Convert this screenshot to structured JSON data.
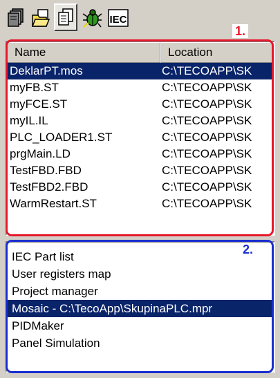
{
  "toolbar": {
    "buttons": [
      {
        "icon": "files-icon"
      },
      {
        "icon": "folder-icon"
      },
      {
        "icon": "documents-icon",
        "active": true
      },
      {
        "icon": "bug-icon"
      },
      {
        "icon": "iec-icon",
        "text": "IEC"
      }
    ]
  },
  "callouts": {
    "one": "1.",
    "two": "2."
  },
  "file_list": {
    "columns": [
      "Name",
      "Location"
    ],
    "rows": [
      {
        "name": "DeklarPT.mos",
        "location": "C:\\TECOAPP\\SK",
        "selected": true
      },
      {
        "name": "myFB.ST",
        "location": "C:\\TECOAPP\\SK"
      },
      {
        "name": "myFCE.ST",
        "location": "C:\\TECOAPP\\SK"
      },
      {
        "name": "myIL.IL",
        "location": "C:\\TECOAPP\\SK"
      },
      {
        "name": "PLC_LOADER1.ST",
        "location": "C:\\TECOAPP\\SK"
      },
      {
        "name": "prgMain.LD",
        "location": "C:\\TECOAPP\\SK"
      },
      {
        "name": "TestFBD.FBD",
        "location": "C:\\TECOAPP\\SK"
      },
      {
        "name": "TestFBD2.FBD",
        "location": "C:\\TECOAPP\\SK"
      },
      {
        "name": "WarmRestart.ST",
        "location": "C:\\TECOAPP\\SK"
      }
    ]
  },
  "window_list": {
    "items": [
      {
        "label": "IEC Part list"
      },
      {
        "label": "User registers map"
      },
      {
        "label": "Project manager"
      },
      {
        "label": "Mosaic - C:\\TecoApp\\SkupinaPLC.mpr",
        "selected": true
      },
      {
        "label": "PIDMaker"
      },
      {
        "label": "Panel Simulation"
      }
    ]
  },
  "colors": {
    "selection": "#0a246a",
    "callout1": "#e8182b",
    "callout2": "#1a2ecf",
    "window_bg": "#d4d0c8"
  }
}
